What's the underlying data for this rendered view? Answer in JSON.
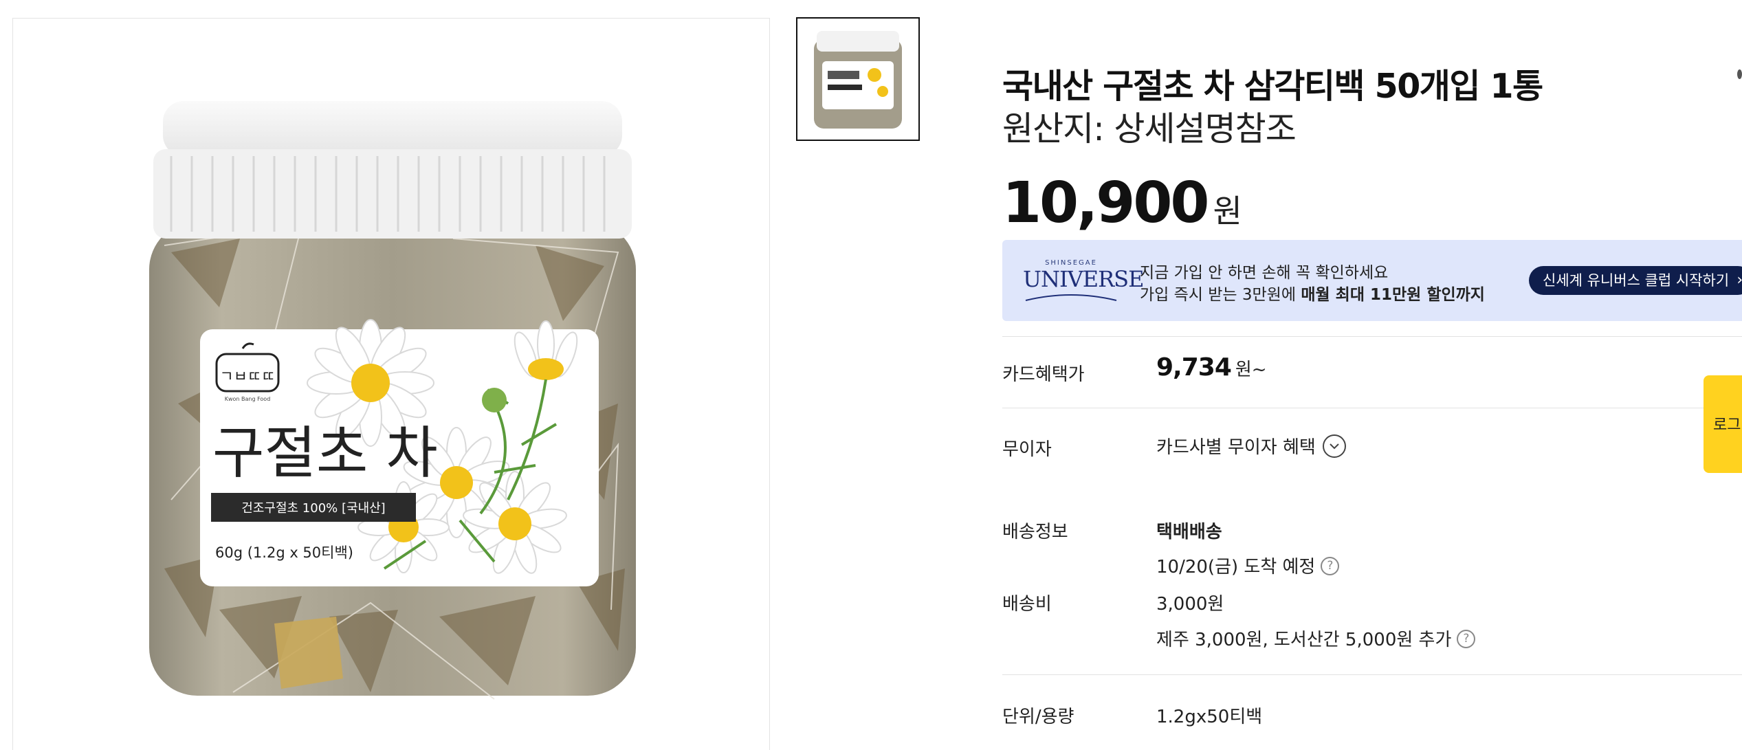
{
  "product": {
    "title": "국내산 구절초 차 삼각티백 50개입 1통",
    "origin": "원산지: 상세설명참조",
    "price": "10,900",
    "price_unit": "원"
  },
  "image_label": {
    "brand_logo_text": "ㄱㅂㄸㄸ",
    "brand_sub": "Kwon Bang Food",
    "name": "구절초 차",
    "banner": "건조구절초 100% [국내산]",
    "weight": "60g (1.2g x 50티백)"
  },
  "promo": {
    "brand_small": "SHINSEGAE",
    "brand_big": "UNIVERSE",
    "line1": "지금 가입 안 하면 손해 꼭 확인하세요",
    "line2_prefix": "가입 즉시 받는 3만원에 ",
    "line2_bold": "매월 최대 11만원 할인까지",
    "cta": "신세계 유니버스 클럽 시작하기",
    "colors": {
      "bg": "#dfe6fb",
      "cta_bg": "#0f1e4c"
    }
  },
  "rows": {
    "card_label": "카드혜택가",
    "card_price": "9,734",
    "card_suffix": "원~",
    "interest_label": "무이자",
    "interest_value": "카드사별 무이자 혜택",
    "shipping_label": "배송정보",
    "shipping_method": "택배배송",
    "shipping_eta": "10/20(금) 도착 예정",
    "fee_label": "배송비",
    "fee_value": "3,000원",
    "fee_extra": "제주  3,000원, 도서산간  5,000원 추가",
    "unit_label": "단위/용량",
    "unit_value": "1.2gx50티백"
  },
  "side_tab": {
    "label": "로그",
    "color": "#ffd21f"
  },
  "icons": [
    "chevron-down-icon",
    "help-icon",
    "chevron-right-icon"
  ]
}
